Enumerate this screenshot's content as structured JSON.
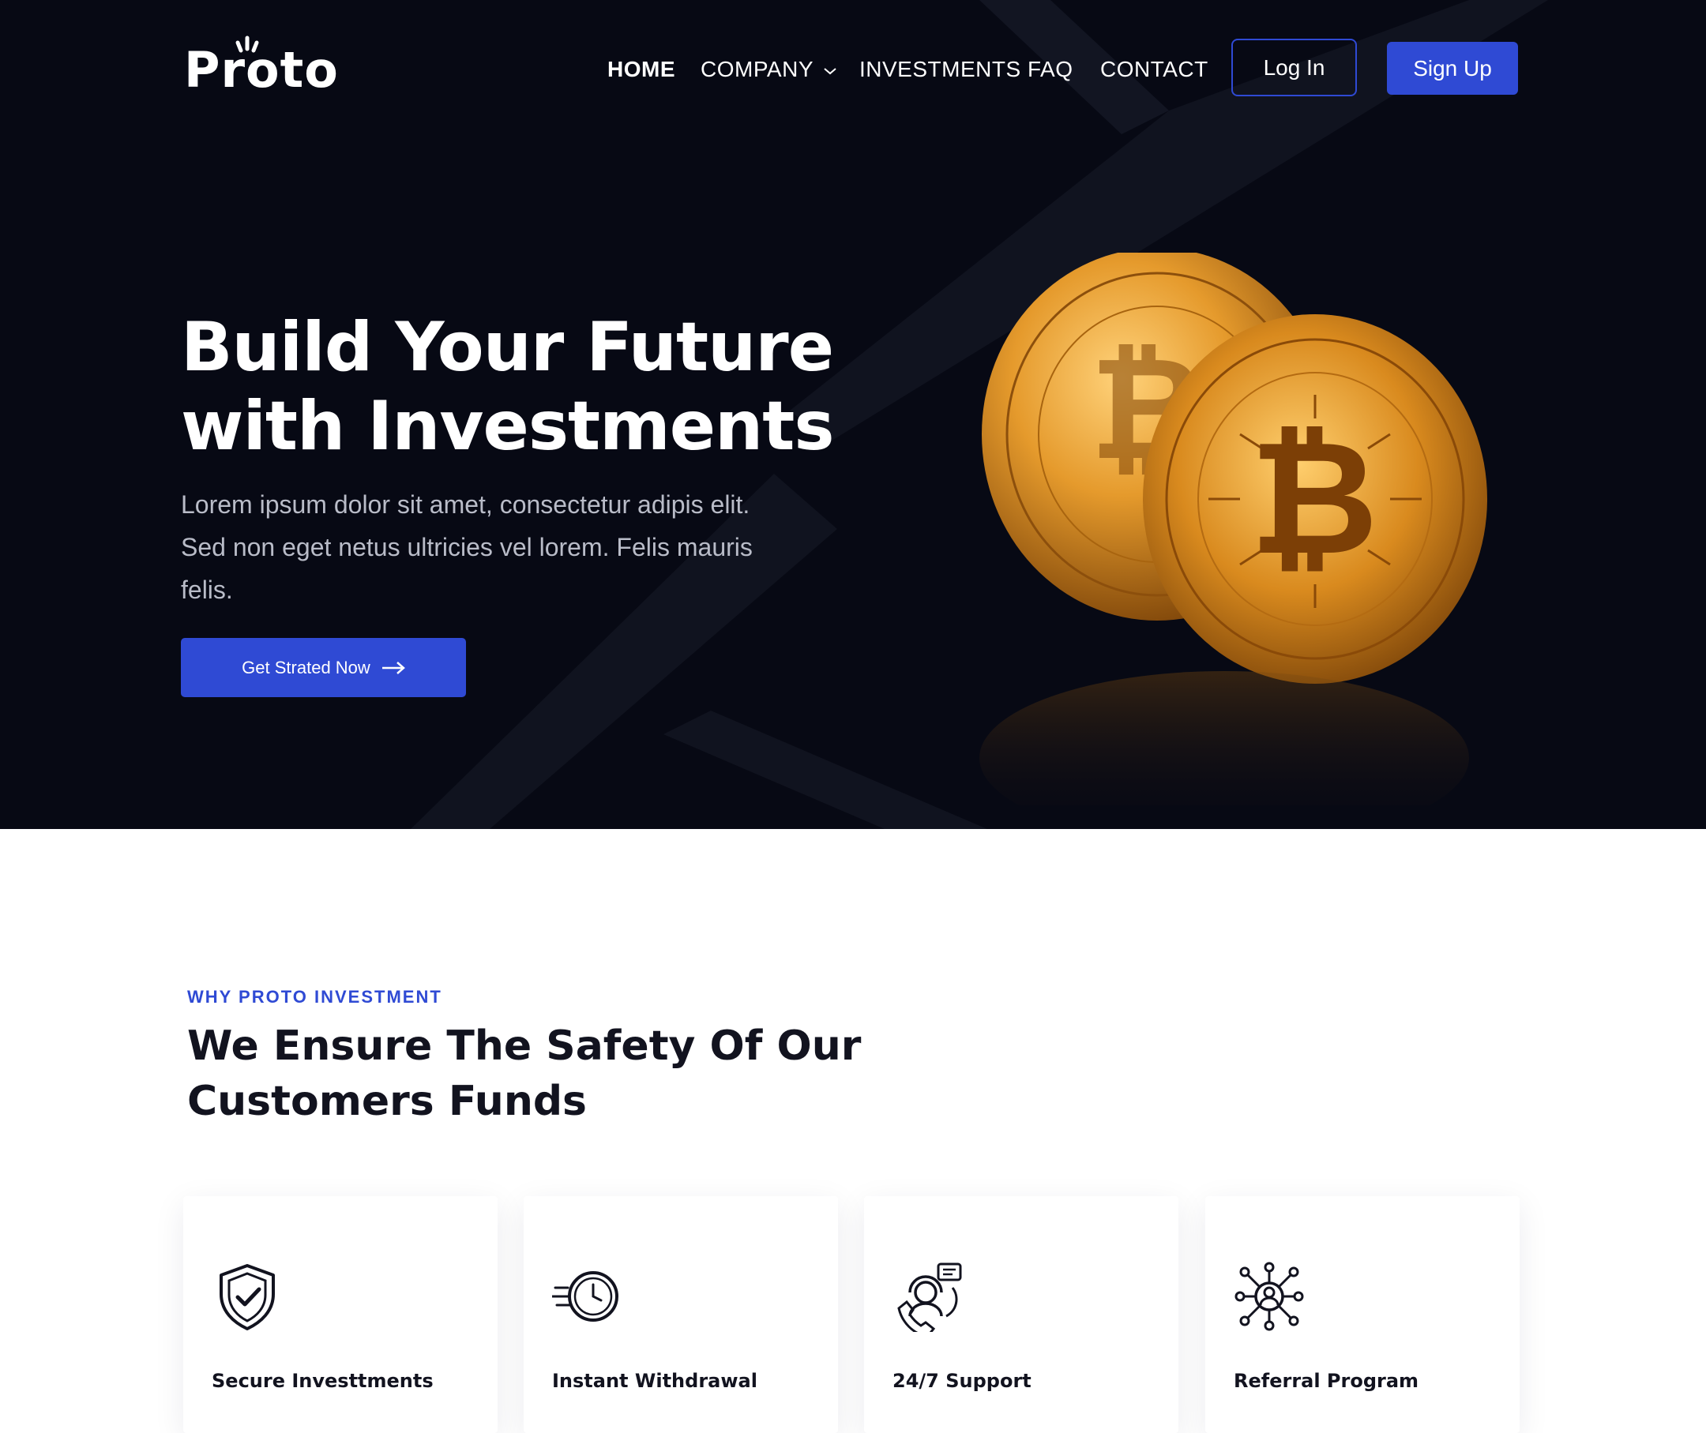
{
  "brand": {
    "logo_text": "Proto"
  },
  "nav": {
    "items": [
      {
        "label": "HOME",
        "active": true
      },
      {
        "label": "COMPANY",
        "has_dropdown": true
      },
      {
        "label": "INVESTMENTS"
      },
      {
        "label": "FAQ"
      },
      {
        "label": "CONTACT"
      }
    ],
    "login_label": "Log In",
    "signup_label": "Sign Up"
  },
  "hero": {
    "title_line1": "Build Your Future",
    "title_line2": "with Investments",
    "description": "Lorem ipsum dolor sit amet, consectetur adipis elit. Sed non eget netus ultricies vel lorem. Felis mauris felis.",
    "cta_label": "Get Strated Now",
    "image": "bitcoin-coins"
  },
  "why": {
    "eyebrow": "WHY PROTO INVESTMENT",
    "title_line1": "We Ensure The Safety Of Our",
    "title_line2": "Customers Funds"
  },
  "features": [
    {
      "title": "Secure Investtments",
      "icon": "shield-check-icon"
    },
    {
      "title": "Instant Withdrawal",
      "icon": "fast-clock-icon"
    },
    {
      "title": "24/7 Support",
      "icon": "support-agent-icon"
    },
    {
      "title": "Referral Program",
      "icon": "network-user-icon"
    }
  ],
  "colors": {
    "hero_bg": "#070914",
    "accent": "#2f4ad4",
    "heading": "#12131f",
    "body_muted": "#b9bcc8"
  }
}
